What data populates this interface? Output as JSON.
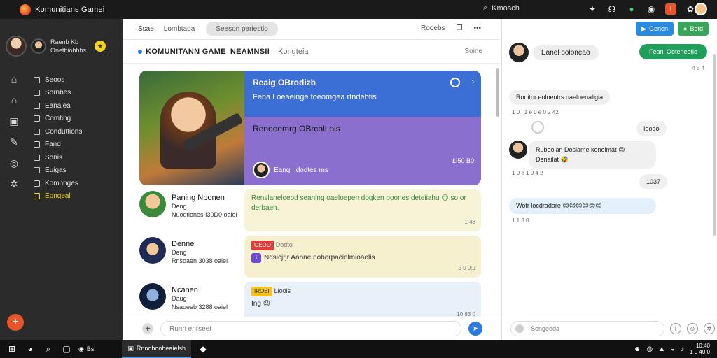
{
  "window": {
    "title": "Komunitians Gamei",
    "search_label": "Kmosch"
  },
  "profile": {
    "line1": "Raenb Kb",
    "line2": "Onetbiohhhs",
    "coin": "★"
  },
  "sidebar": {
    "items": [
      {
        "label": "Seoos"
      },
      {
        "label": "Sornbes"
      },
      {
        "label": "Eanaiea"
      },
      {
        "label": "Comting"
      },
      {
        "label": "Conduttions"
      },
      {
        "label": "Fand"
      },
      {
        "label": "Sonis"
      },
      {
        "label": "Euigas"
      },
      {
        "label": "Komnnges"
      },
      {
        "label": "Eongeal"
      }
    ]
  },
  "tabs": {
    "home": "Ssae",
    "second": "Lombtaoa",
    "pill": "Seeson pariestlo",
    "right_label": "Rooebs"
  },
  "header": {
    "title": "KOMUNITANN GAME",
    "title2": "NEAMNSII",
    "subtitle": "Kongteia",
    "right": "Soine"
  },
  "hero": {
    "headline": "Reaig OBrodizb",
    "sub": "Fena I oeaeinge toeomgea rtndebtis",
    "body_title": "Reneoemrg OBrcolLois",
    "footer_text": "Eang I dodtes ms",
    "footer_right": "£I50 B0"
  },
  "posts": [
    {
      "name": "Paning Nbonen",
      "line2": "Deng",
      "line3": "Nuoqtiones I30D0 oaiel",
      "text": "Renslaneloeod seaning oaeloepen dogken ooones deteiiahu 😊 so or derbaeh.",
      "time": "1 48"
    },
    {
      "name": "Denne",
      "line2": "Deng",
      "line3": "Rnsoaen 3038 oaiel",
      "badge": "GEOO",
      "badge_text": "Dodto",
      "text": "Ndsicjrjr Aanne noberpacielmioaelis",
      "time": "5 0 9:9"
    },
    {
      "name": "Ncanen",
      "line2": "Daug",
      "line3": "Nsaoeeb 3288 oaiel",
      "badge": "IROBI",
      "badge_text": "Lioois",
      "text": "Ing 😉",
      "time": "10 83 0"
    }
  ],
  "composer": {
    "placeholder": "Runn enrseet"
  },
  "chat": {
    "btn1": "Genen",
    "btn2": "Betd",
    "head_name": "Eanel ooloneao",
    "green_msg": "Feani Ooteneotio",
    "green_time": "4 5 4",
    "messages": [
      {
        "text": "Rooitor eolnentrs oaeloenaligia",
        "time": "1 0 : 1 e 0 e 0 2 42"
      },
      {
        "text": "Ioooo"
      },
      {
        "text": "Rubeolan Doslame keneimat 😊 Denailat 🤣",
        "time": "1 0 e 1 0 4 2"
      },
      {
        "text": "1037"
      },
      {
        "text": "Wotr locdradare 😊😊😊😊😊😊",
        "time": "1 1 3 0"
      }
    ],
    "composer_placeholder": "Songeoda"
  },
  "taskbar": {
    "app1": "Bsi",
    "app2": "Rnnobooheaielsh",
    "clock_time": "10:40",
    "clock_date": "1 0 40 0"
  }
}
